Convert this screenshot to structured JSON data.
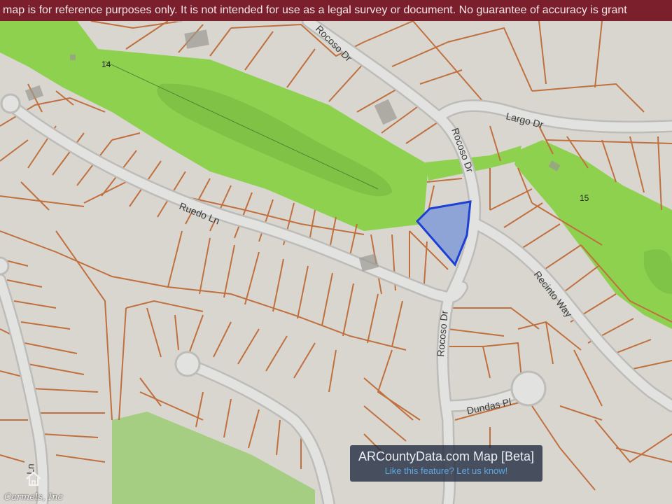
{
  "banner": {
    "text": "map is for reference purposes only. It is not intended for use as a legal survey or document. No guarantee of accuracy is grant"
  },
  "road_labels": {
    "rocoso_top": "Rocoso Dr",
    "largo": "Largo Dr",
    "rocoso_mid": "Rocoso Dr",
    "ruedo": "Ruedo Ln",
    "recinto": "Recinto Way",
    "rocoso_low": "Rocoso Dr",
    "dundas": "Dundas Pl",
    "ln": "Ln"
  },
  "lot_numbers": {
    "left_green": "14",
    "right_green": "15"
  },
  "attribution": {
    "title": "ARCountyData.com Map [Beta]",
    "link": "Like this feature? Let us know!"
  },
  "watermark": {
    "text": "Carmels, Inc"
  },
  "colors": {
    "background": "#d9d6d0",
    "road": "#e2e2e0",
    "road_edge": "#bdbcb8",
    "parcel_line": "#c0703e",
    "golf_green": "#8ed14f",
    "golf_dark": "#6fb43c",
    "highlight_fill": "#8fa4d6",
    "highlight_stroke": "#1c3fd4",
    "banner": "#7c1f2c"
  },
  "icons": {
    "watermark": "house-logo-icon"
  }
}
